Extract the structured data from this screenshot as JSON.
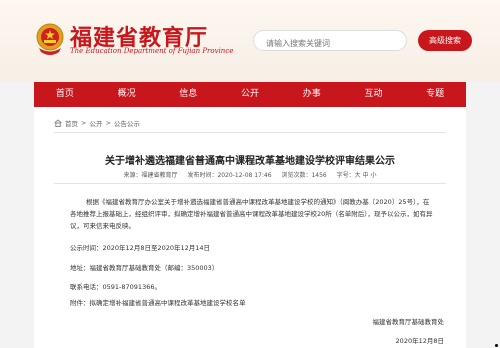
{
  "header": {
    "title": "福建省教育厅",
    "subtitle": "The Education Department of Fujian Province",
    "search_placeholder": "请输入搜索关键词",
    "search_button": "高级搜索"
  },
  "nav": {
    "items": [
      "首页",
      "概况",
      "信息",
      "公开",
      "办事",
      "互动",
      "专题"
    ]
  },
  "breadcrumb": {
    "home": "首页",
    "sep1": " > ",
    "level1": "公开",
    "sep2": " > ",
    "level2": "公告公示"
  },
  "article": {
    "title": "关于增补遴选福建省普通高中课程改革基地建设学校评审结果公示",
    "meta": {
      "source": "来源：福建省教育厅",
      "date": "发布时间：2020-12-08 17:46",
      "views": "浏览次数：1456",
      "font_size": "字号：大 中 小"
    },
    "paragraph": "根据《福建省教育厅办公室关于增补遴选福建省普通高中课程改革基地建设学校的通知》（闽教办基〔2020〕25号），在各地推荐上报基础上，经组织评审，拟确定增补福建省普通高中课程改革基地建设学校20所（名单附后），现予以公示，如有异议，可来信来电反映。",
    "period": "公示时间：2020年12月8日至2020年12月14日",
    "address": "地址：福建省教育厅基础教育处（邮编：350003）",
    "phone": "联系电话：0591-87091366。",
    "attachment": "附件：拟确定增补福建省普通高中课程改革基地建设学校名单",
    "signature": "福建省教育厅基础教育处",
    "sign_date": "2020年12月8日"
  }
}
